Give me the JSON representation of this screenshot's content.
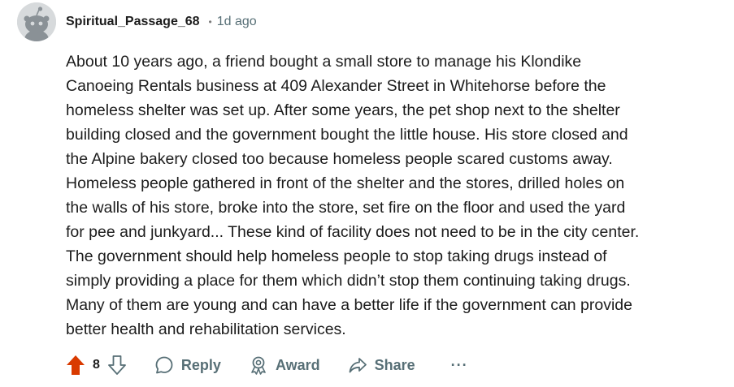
{
  "comment": {
    "author": "Spiritual_Passage_68",
    "separator": "•",
    "time": "1d ago",
    "body_lines": [
      "About 10 years ago, a friend bought a small store to manage his Klondike",
      "Canoeing Rentals business at 409 Alexander Street in Whitehorse before the",
      "homeless shelter was set up. After some years, the pet shop next to the shelter",
      "building closed and the government bought the little house. His store closed and",
      "the Alpine bakery closed too because homeless people scared customs away.",
      "Homeless people gathered in front of the shelter and the stores, drilled holes on",
      "the walls of his store, broke into the store, set fire on the floor and used the yard",
      "for pee and junkyard... These kind of facility does not need to be in the city center.",
      "The government should help homeless people to stop taking drugs instead of",
      "simply providing a place for them which didn’t stop them continuing taking drugs.",
      "Many of them are young and can have a better life if the government can provide",
      "better health and rehabilitation services."
    ],
    "score": "8",
    "actions": {
      "reply": "Reply",
      "award": "Award",
      "share": "Share",
      "more": "···"
    }
  },
  "colors": {
    "upvote": "#d93a00",
    "muted": "#576f76",
    "text": "#1c1c1c"
  }
}
